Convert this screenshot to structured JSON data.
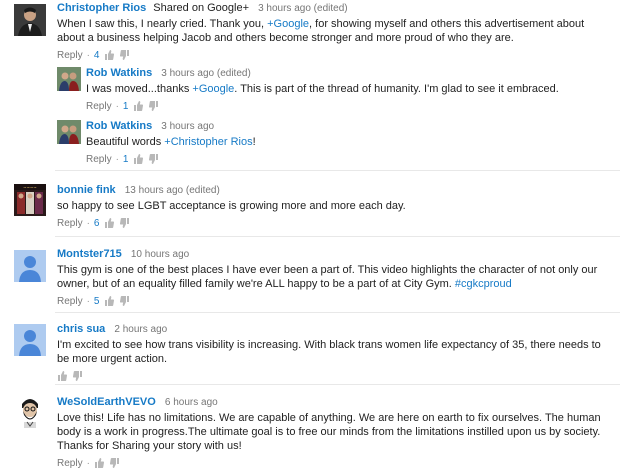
{
  "labels": {
    "reply": "Reply",
    "dot": "·"
  },
  "colors": {
    "link": "#167ac6",
    "meta": "#767676",
    "separator": "#e8e8e8"
  },
  "comments": [
    {
      "author": "Christopher Rios",
      "shared": "Shared on Google+",
      "time": "3 hours ago (edited)",
      "text_parts": [
        "When I saw this, I nearly cried. Thank you, ",
        "+Google",
        ", for showing myself and others this advertisement about about a business helping Jacob and others become stronger and more proud of who they are."
      ],
      "likes": "4",
      "avatar": "photo-man-suit"
    },
    {
      "author": "Rob Watkins",
      "time": "3 hours ago (edited)",
      "text_parts": [
        "I was moved...thanks ",
        "+Google",
        ". This is part of the thread of humanity. I'm glad to see it embraced."
      ],
      "likes": "1",
      "avatar": "photo-couple"
    },
    {
      "author": "Rob Watkins",
      "time": "3 hours ago",
      "text_parts": [
        "Beautiful words ",
        "+Christopher Rios",
        "!"
      ],
      "likes": "1",
      "avatar": "photo-couple"
    },
    {
      "author": "bonnie fink",
      "time": "13 hours ago (edited)",
      "text": "so happy to see LGBT acceptance is growing more and more each day.",
      "likes": "6",
      "avatar": "photo-poster"
    },
    {
      "author": "Montster715",
      "time": "10 hours ago",
      "text_parts": [
        "This gym is one of the best places I have ever been a part of. This video highlights the character of not only our owner, but of an equality filled family we're ALL happy to be a part of at City Gym. ",
        "#cgkcproud"
      ],
      "likes": "5",
      "avatar": "default-user"
    },
    {
      "author": "chris sua",
      "time": "2 hours ago",
      "text": "I'm excited to see how trans visibility is increasing. With black trans women life expectancy of 35, there needs to be more urgent action.",
      "avatar": "default-user"
    },
    {
      "author": "WeSoldEarthVEVO",
      "time": "6 hours ago",
      "text": "Love this! Life has no limitations. We are capable of anything. We are here on earth to fix ourselves. The human body is a work in progress.The ultimate goal is to free our minds from the limitations instilled upon us by society. Thanks for Sharing your story with us!",
      "avatar": "illustration-bearded-man"
    }
  ]
}
